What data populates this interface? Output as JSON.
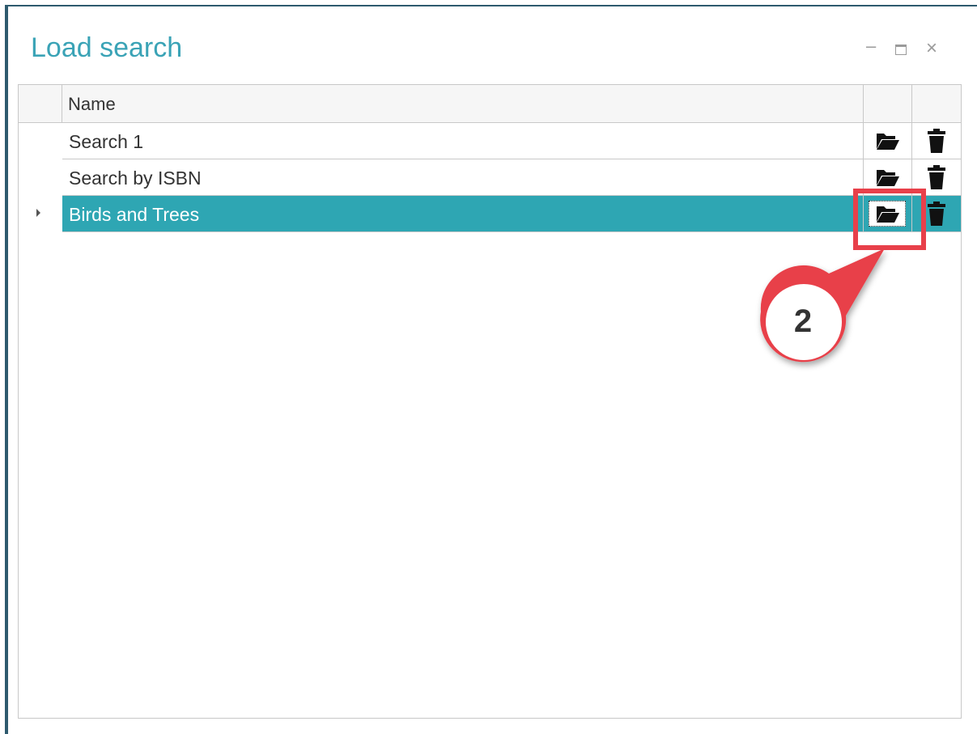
{
  "window": {
    "title": "Load search",
    "controls": {
      "minimize": "–",
      "maximize": "□",
      "close": "×"
    }
  },
  "grid": {
    "columns": [
      "Name",
      "",
      ""
    ],
    "rows": [
      {
        "name": "Search 1",
        "selected": false
      },
      {
        "name": "Search by ISBN",
        "selected": false
      },
      {
        "name": "Birds and Trees",
        "selected": true
      }
    ]
  },
  "annotation": {
    "callout_number": "2",
    "highlight_color": "#e8404a"
  },
  "colors": {
    "accent": "#2ea6b3",
    "title": "#3aa3b6",
    "frame": "#2e5a6e"
  },
  "icons": {
    "open": "folder-open-icon",
    "delete": "trash-icon"
  }
}
